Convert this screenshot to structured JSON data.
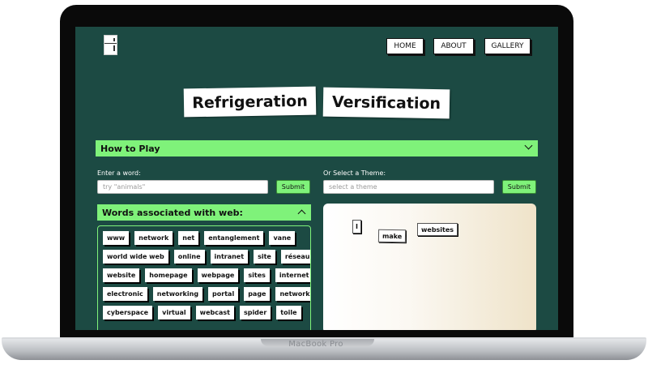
{
  "laptop": {
    "label": "MacBook Pro"
  },
  "nav": {
    "home": "HOME",
    "about": "ABOUT",
    "gallery": "GALLERY"
  },
  "title": {
    "word1": "Refrigeration",
    "word2": "Versification"
  },
  "how_to_play": {
    "label": "How to Play"
  },
  "word_form": {
    "label": "Enter a word:",
    "placeholder": "try \"animals\"",
    "submit": "Submit"
  },
  "theme_form": {
    "label": "Or Select a Theme:",
    "placeholder": "select a theme",
    "submit": "Submit"
  },
  "words_panel": {
    "label": "Words associated with web:",
    "rows": [
      [
        "www",
        "network",
        "net",
        "entanglement",
        "vane"
      ],
      [
        "world wide web",
        "online",
        "intranet",
        "site",
        "réseau"
      ],
      [
        "website",
        "homepage",
        "webpage",
        "sites",
        "internet"
      ],
      [
        "electronic",
        "networking",
        "portal",
        "page",
        "networks"
      ],
      [
        "cyberspace",
        "virtual",
        "webcast",
        "spider",
        "toile"
      ]
    ]
  },
  "fridge_board": {
    "magnets": [
      "I",
      "make",
      "websites"
    ]
  },
  "colors": {
    "background": "#1c4a43",
    "accent": "#7ff27a",
    "card": "#ffffff"
  },
  "icons": {
    "logo": "fridge-icon",
    "collapse": "chevron-up-icon",
    "expand": "chevron-down-icon"
  }
}
